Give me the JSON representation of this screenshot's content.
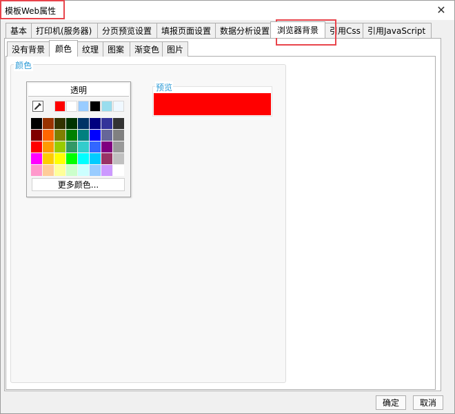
{
  "window": {
    "title": "模板Web属性"
  },
  "main_tabs": [
    "基本",
    "打印机(服务器)",
    "分页预览设置",
    "填报页面设置",
    "数据分析设置",
    "浏览器背景",
    "引用Css",
    "引用JavaScript"
  ],
  "sub_tabs": [
    "没有背景",
    "颜色",
    "纹理",
    "图案",
    "渐变色",
    "图片"
  ],
  "color_group": {
    "label": "颜色",
    "transparent_label": "透明",
    "more_colors_label": "更多颜色...",
    "recent_colors": [
      "#ff0000",
      "#ffffff",
      "#99ccff",
      "#000000",
      "#99ddee",
      "#f0f8ff"
    ],
    "palette": [
      [
        "#000000",
        "#993300",
        "#333300",
        "#003300",
        "#003366",
        "#000080",
        "#333399",
        "#333333"
      ],
      [
        "#800000",
        "#ff6600",
        "#808000",
        "#008000",
        "#008080",
        "#0000ff",
        "#666699",
        "#808080"
      ],
      [
        "#ff0000",
        "#ff9900",
        "#99cc00",
        "#339966",
        "#33cccc",
        "#3366ff",
        "#800080",
        "#999999"
      ],
      [
        "#ff00ff",
        "#ffcc00",
        "#ffff00",
        "#00ff00",
        "#00ffff",
        "#00ccff",
        "#993366",
        "#c0c0c0"
      ],
      [
        "#ff99cc",
        "#ffcc99",
        "#ffff99",
        "#ccffcc",
        "#ccffff",
        "#99ccff",
        "#cc99ff",
        "#ffffff"
      ]
    ]
  },
  "preview": {
    "label": "预览",
    "color": "#ff0000"
  },
  "buttons": {
    "ok": "确定",
    "cancel": "取消"
  },
  "colors": {
    "highlight": "#e8434a",
    "group_label": "#2d9bd6"
  }
}
